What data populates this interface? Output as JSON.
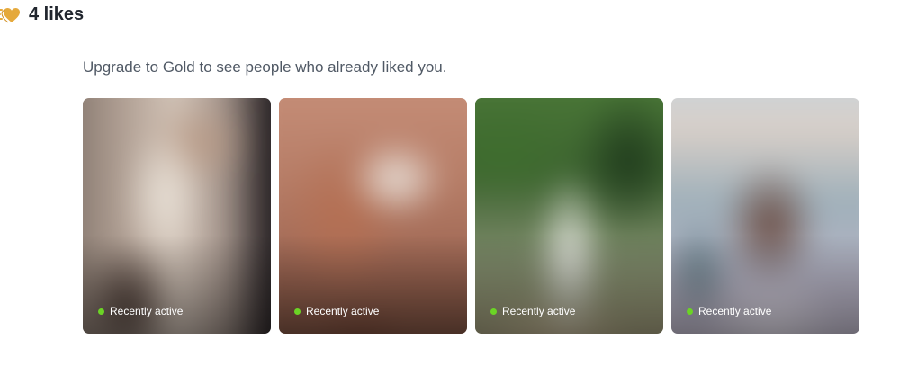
{
  "header": {
    "likes_icon": "gold-hearts-icon",
    "title": "4 likes"
  },
  "main": {
    "subtitle": "Upgrade to Gold to see people who already liked you.",
    "status_dot_color": "#6bd425",
    "cards": [
      {
        "status": "Recently active"
      },
      {
        "status": "Recently active"
      },
      {
        "status": "Recently active"
      },
      {
        "status": "Recently active"
      }
    ]
  },
  "colors": {
    "gold": "#e5a93c",
    "title_text": "#21262e",
    "subtitle_text": "#505965"
  }
}
